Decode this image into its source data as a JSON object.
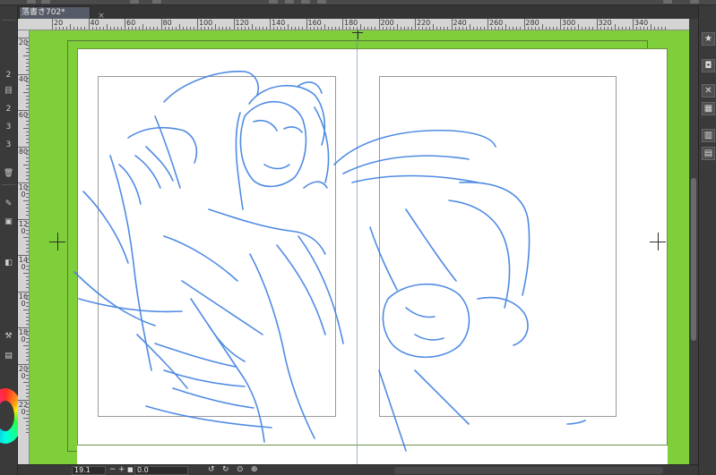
{
  "tab": {
    "label": "落書き702*",
    "close": "×"
  },
  "ruler": {
    "labels": [
      "20",
      "40",
      "60",
      "80",
      "100",
      "120",
      "140",
      "160",
      "180",
      "200",
      "220",
      "240",
      "260",
      "280",
      "300",
      "320",
      "340"
    ]
  },
  "v_ruler": {
    "labels": [
      "20",
      "40",
      "60",
      "80",
      "100",
      "120",
      "140",
      "160",
      "180",
      "200",
      "220"
    ]
  },
  "left_panel": {
    "items": [
      "2",
      "目",
      "2",
      "3",
      "3"
    ]
  },
  "status": {
    "zoom": "19.1",
    "minus": "−",
    "plus": "+",
    "rotation": "0.0"
  },
  "colors": {
    "canvas_bg": "#7fcf3a",
    "sketch_blue": "#3d7fe0"
  },
  "icons": [
    "star-icon",
    "camera-icon",
    "close-x-icon",
    "grid-icon",
    "layers-icon",
    "document-icon",
    "trash-icon"
  ]
}
